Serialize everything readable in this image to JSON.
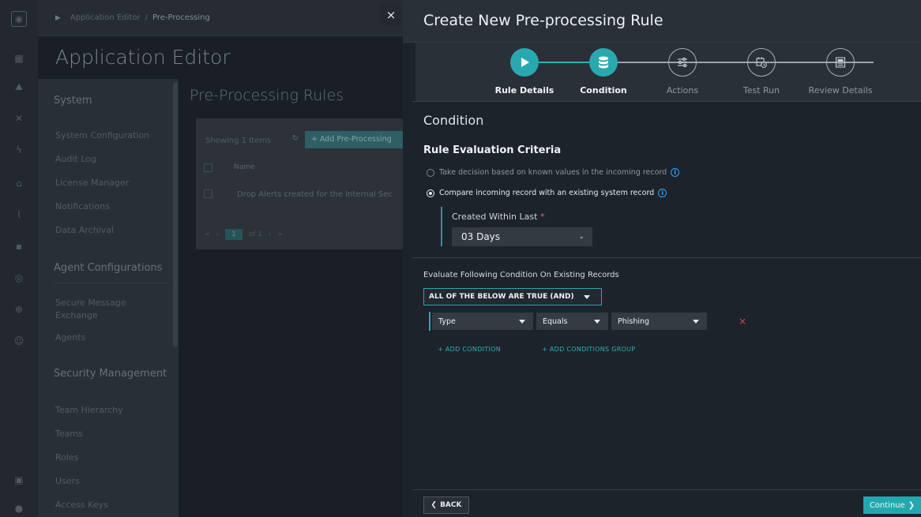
{
  "background": {
    "breadcrumb": {
      "parent": "Application Editor",
      "sep": "/",
      "current": "Pre-Processing"
    },
    "app_title": "Application Editor",
    "nav": {
      "section_system": "System",
      "system_items": [
        "System Configuration",
        "Audit Log",
        "License Manager",
        "Notifications",
        "Data Archival"
      ],
      "section_agent": "Agent Configurations",
      "agent_items": [
        "Secure Message Exchange",
        "Agents"
      ],
      "section_security": "Security Management",
      "security_items": [
        "Team Hierarchy",
        "Teams",
        "Roles",
        "Users",
        "Access Keys"
      ]
    },
    "main_title": "Pre-Processing Rules",
    "table": {
      "showing": "Showing 1 Items",
      "add_button": "+ Add Pre-Processing",
      "col_name": "Name",
      "rows": [
        "Drop Alerts created for the Internal Sec"
      ],
      "pager": {
        "prev_all": "«",
        "prev": "‹",
        "page": "1",
        "of": "of 1",
        "next": "›",
        "next_all": "»"
      }
    },
    "close_glyph": "×"
  },
  "panel": {
    "title": "Create New Pre-processing Rule",
    "steps": [
      {
        "label": "Rule Details",
        "state": "active",
        "icon": "play-icon"
      },
      {
        "label": "Condition",
        "state": "active",
        "icon": "database-icon"
      },
      {
        "label": "Actions",
        "state": "pending",
        "icon": "sliders-icon"
      },
      {
        "label": "Test Run",
        "state": "pending",
        "icon": "calendar-clock-icon"
      },
      {
        "label": "Review Details",
        "state": "pending",
        "icon": "document-icon"
      }
    ],
    "section_title": "Condition",
    "criteria_title": "Rule Evaluation Criteria",
    "option_known": "Take decision based on known values in the incoming record",
    "option_compare": "Compare incoming record with an existing system record",
    "created_within_label": "Created Within Last",
    "required_mark": "*",
    "created_within_value": "03 Days",
    "evaluate_title": "Evaluate Following Condition On Existing Records",
    "logic_value": "ALL OF THE BELOW ARE TRUE (AND)",
    "condition": {
      "field": "Type",
      "operator": "Equals",
      "value": "Phishing",
      "remove": "×"
    },
    "add_condition": "+ ADD CONDITION",
    "add_group": "+ ADD CONDITIONS GROUP",
    "back_label": "BACK",
    "continue_label": "Continue"
  },
  "colors": {
    "accent": "#2aa8b0",
    "danger": "#e0474a",
    "info": "#2fa3ff",
    "panel_bg": "#1d232a"
  }
}
